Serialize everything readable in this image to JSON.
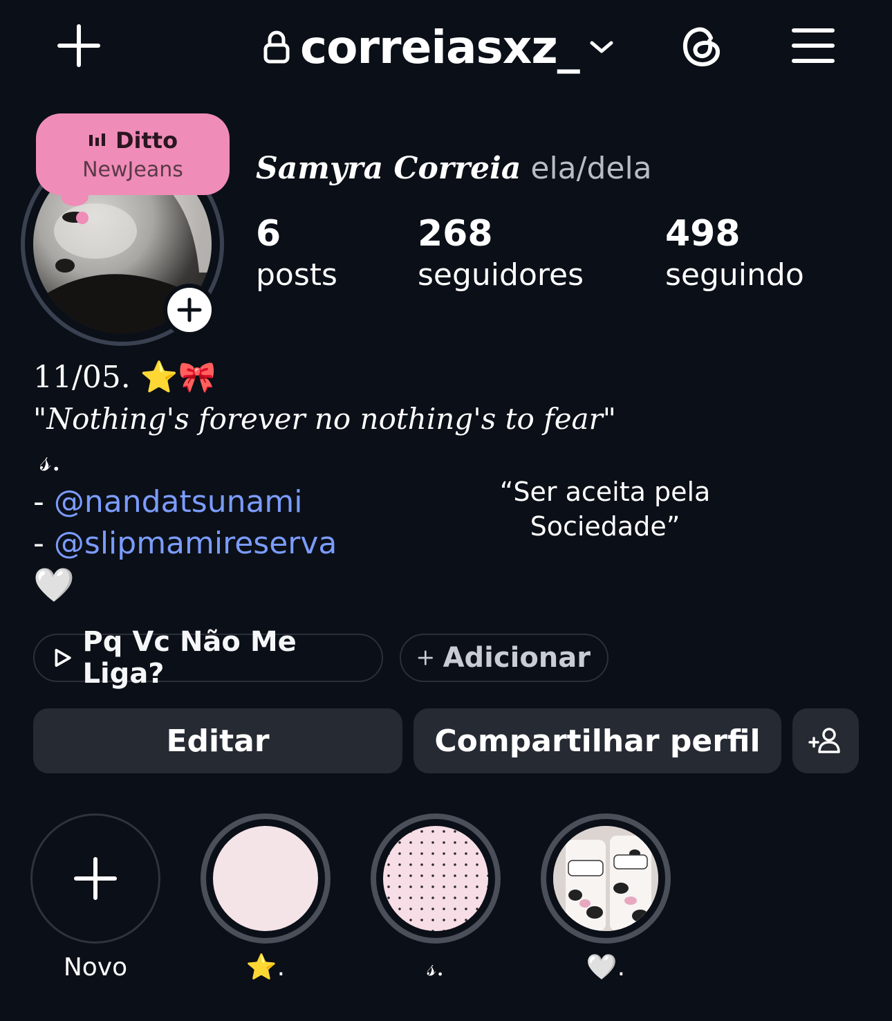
{
  "header": {
    "new_icon": "plus-icon",
    "lock_icon": "lock-icon",
    "username": "correiasxz_",
    "switch_icon": "chevron-down-icon",
    "threads_icon": "threads-icon",
    "menu_icon": "hamburger-menu-icon"
  },
  "note": {
    "title": "Ditto",
    "subtitle": "NewJeans",
    "icon": "music-bars-icon",
    "color": "#f08cb8"
  },
  "profile": {
    "full_name": "Samyra Correia",
    "pronouns": "ela/dela",
    "add_story_icon": "plus-icon"
  },
  "stats": [
    {
      "value": "6",
      "label": "posts"
    },
    {
      "value": "268",
      "label": "seguidores"
    },
    {
      "value": "498",
      "label": "seguindo"
    }
  ],
  "bio": {
    "line1": "11/05. ⭐🎀",
    "line2": "\"Nothing's forever no nothing's to fear\"",
    "line3": "𝓈.",
    "dash": "-",
    "mention1": "@nandatsunami",
    "mention2": "@slipmamireserva",
    "line6": "🤍"
  },
  "overlay_text": {
    "line1": "“Ser aceita pela",
    "line2": "Sociedade”"
  },
  "music_pill": {
    "icon": "play-icon",
    "label": "Pq Vc Não Me Liga?"
  },
  "add_pill": {
    "icon": "plus-icon",
    "label": "Adicionar"
  },
  "actions": {
    "edit": "Editar",
    "share": "Compartilhar perfil",
    "add_person_icon": "add-person-icon"
  },
  "highlights": [
    {
      "label": "Novo",
      "icon": "plus-icon"
    },
    {
      "label": "⭐."
    },
    {
      "label": "𝓈."
    },
    {
      "label": "🤍."
    }
  ],
  "colors": {
    "background": "#0b0f17",
    "link": "#7b9cff",
    "button": "#262a33"
  }
}
